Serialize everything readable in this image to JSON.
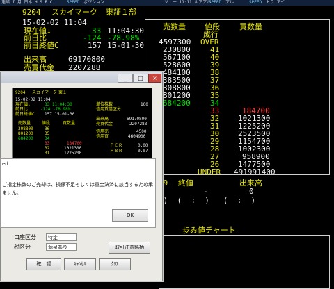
{
  "topbar": {
    "items": [
      "連結 I 月 日本 H S B C",
      "SPEED",
      "ポジション",
      "ソニー 11:11 ルアアル",
      "SPEED",
      "アル",
      "SPEED",
      "トラ アイ"
    ]
  },
  "quote": {
    "code": "9204",
    "name": "スカイマーク",
    "market": "東証１部",
    "date_time": "15-02-02 11:04",
    "current_label": "現在値↓",
    "current_value": "33",
    "current_time": "11:04:30",
    "change_label": "前日比",
    "change_value": "-124",
    "change_pct": "-78.98%",
    "prev_close_label": "前日終値C",
    "prev_close_value": "157",
    "prev_close_date": "15-01-30",
    "volume_label": "出来高",
    "volume_value": "69170800",
    "turnover_label": "売買代金",
    "turnover_value": "2207288"
  },
  "board": {
    "sell_header": "売数量",
    "price_header": "値段",
    "buy_header": "買数量",
    "market_order": "成行",
    "over_label": "OVER",
    "over_qty": "4597300",
    "under_label": "UNDER",
    "under_qty": "491991400",
    "asks": [
      {
        "qty": "230800",
        "price": "41"
      },
      {
        "qty": "567100",
        "price": "40"
      },
      {
        "qty": "528600",
        "price": "39"
      },
      {
        "qty": "484100",
        "price": "38"
      },
      {
        "qty": "383500",
        "price": "37"
      },
      {
        "qty": "308800",
        "price": "36"
      },
      {
        "qty": "801200",
        "price": "35"
      },
      {
        "qty": "684200",
        "price": "34"
      }
    ],
    "bids": [
      {
        "price": "33",
        "qty": "184700"
      },
      {
        "price": "32",
        "qty": "1021300"
      },
      {
        "price": "31",
        "qty": "1225200"
      },
      {
        "price": "30",
        "qty": "2523500"
      },
      {
        "price": "29",
        "qty": "1154700"
      },
      {
        "price": "28",
        "qty": "1002300"
      },
      {
        "price": "27",
        "qty": "958900"
      },
      {
        "price": "26",
        "qty": "1477500"
      }
    ]
  },
  "lower": {
    "price_29": "29",
    "close_label": "終値",
    "dash": "-",
    "volume_label": "出来高",
    "volume_zero": "0",
    "paren_row": "6)  (  :  )   (  :  )",
    "chart_title": "歩み値チャート"
  },
  "window": {
    "mini": {
      "code": "9204",
      "name": "スカイマーク",
      "market": "東１",
      "date_time": "15-02-02 11:04",
      "current_label": "現在値↓",
      "current_value": "33 11:04:30",
      "change_label": "前日比",
      "change_value": "-124 -78.98%",
      "prev_label": "前日終値C",
      "prev_value": "157 15-01-30",
      "unit_label": "単位株数",
      "unit_value": "100",
      "margin_label": "信用貸借区分",
      "volume_label": "出来高",
      "volume_value": "69170800",
      "turnover_label": "売買代金",
      "turnover_value": "2207288",
      "col_sell": "売数量",
      "col_price": "値段",
      "col_buy": "買数量",
      "ask_rows": [
        [
          "308800",
          "36"
        ],
        [
          "801200",
          "35"
        ],
        [
          "684200",
          "34"
        ]
      ],
      "bid_rows": [
        [
          "33",
          "184700"
        ],
        [
          "32",
          "1021300"
        ],
        [
          "31",
          "1225200"
        ]
      ],
      "credit_sell_label": "信用売",
      "credit_sell_value": "4500",
      "credit_buy_label": "信用買",
      "credit_buy_value": "4604900",
      "per_label": "ＰＥＲ",
      "per_value": "0.00",
      "pbr_label": "ＰＢＲ",
      "pbr_value": "0.07"
    },
    "dialog": {
      "title_fragment": "ed",
      "message_line1": "ご指定株数のご売却は、損保不足もしくは重金決済に該当するため承",
      "message_line2": "ません。",
      "ok_label": "OK"
    },
    "form": {
      "account_label": "口座区分",
      "account_value": "特定",
      "tax_label": "税区分",
      "tax_value": "源泉あり",
      "caution_button": "取引注意銘柄",
      "confirm_button": "確　認",
      "cancel_button": "ｷｬﾝｾﾙ",
      "clear_button": "ｸﾘｱ"
    }
  }
}
